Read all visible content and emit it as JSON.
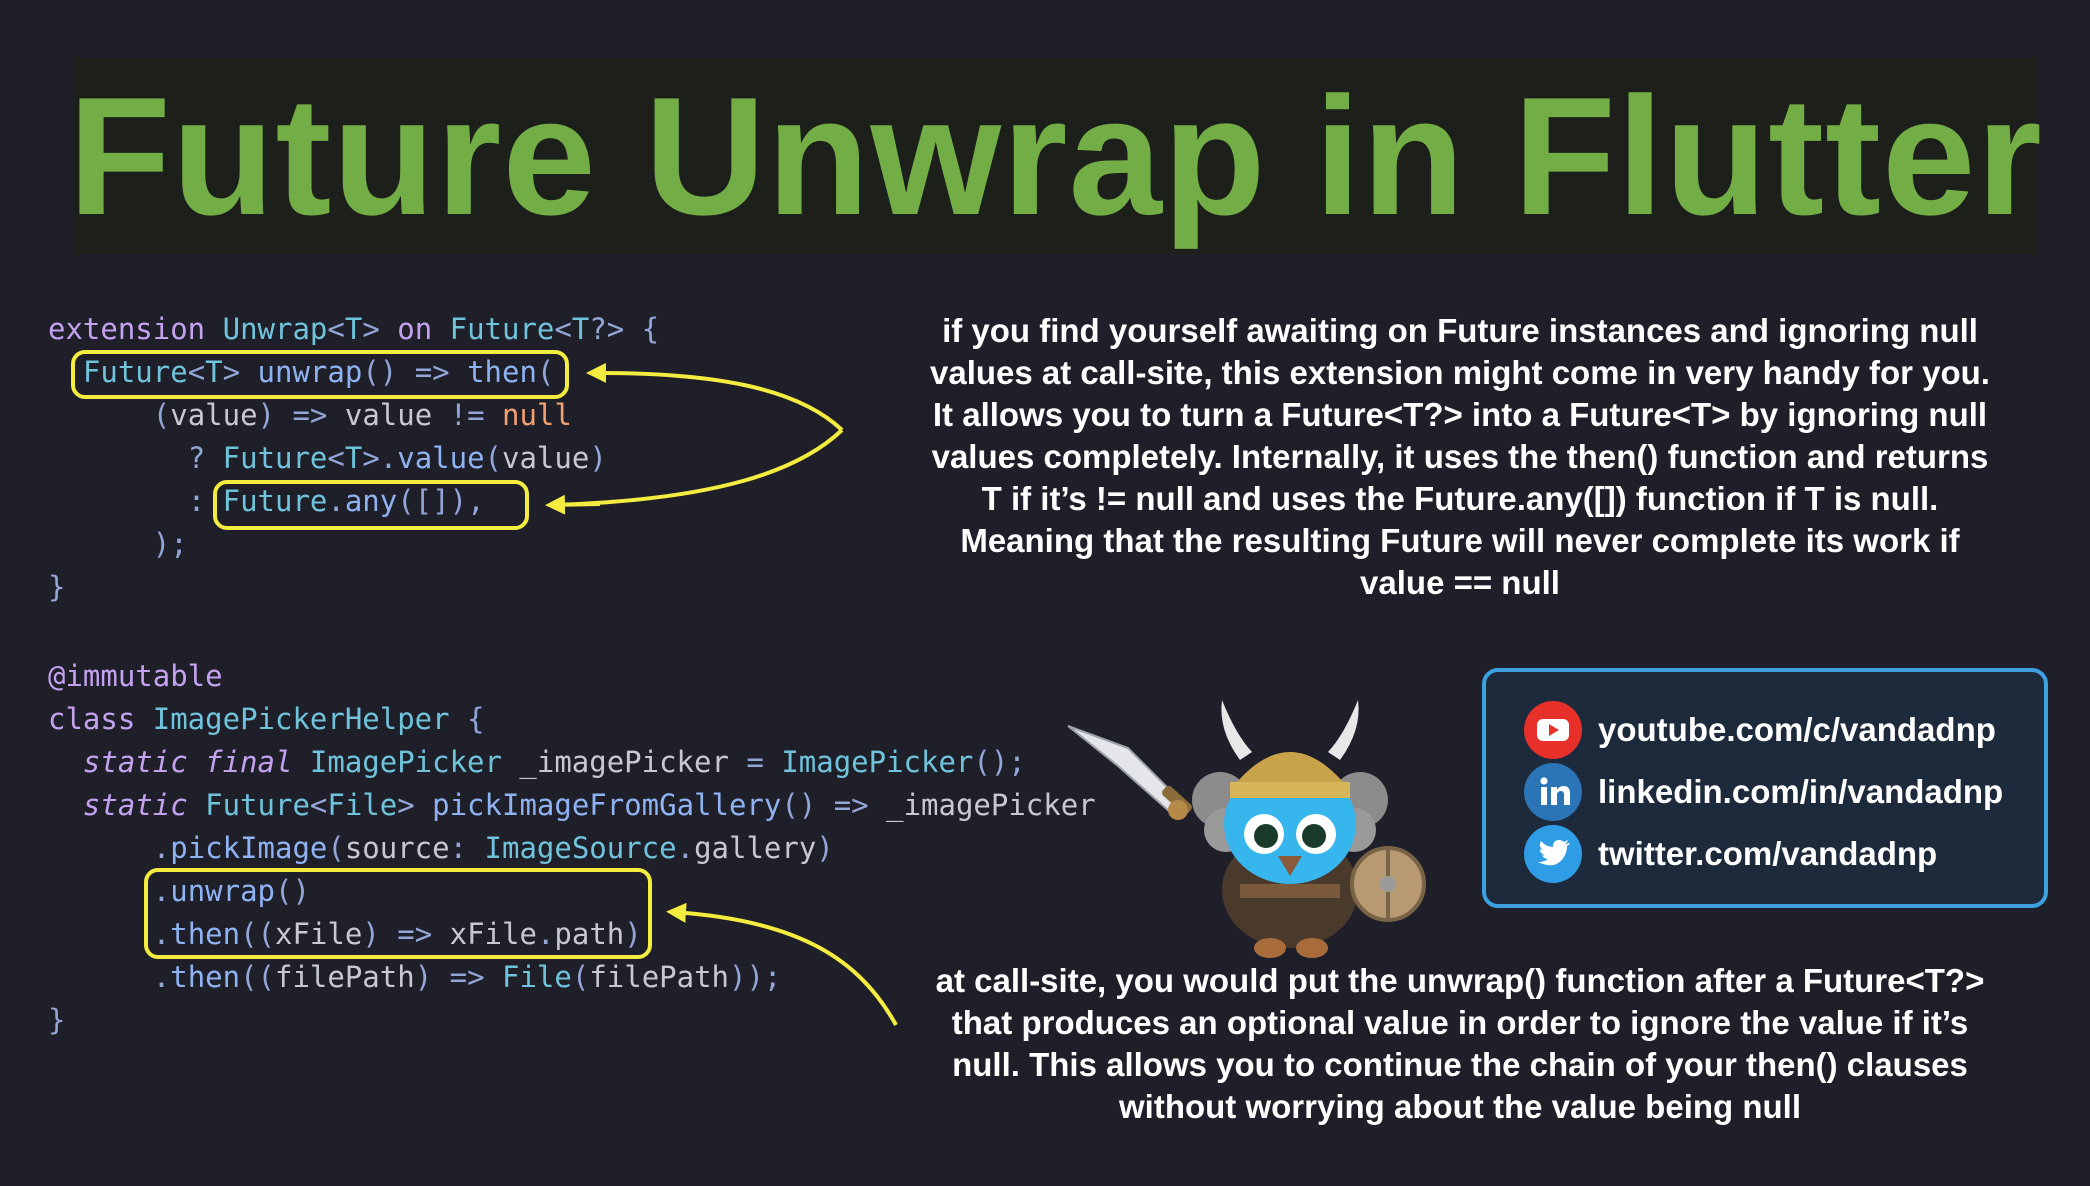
{
  "title": "Future Unwrap in Flutter",
  "code_block_1": [
    [
      [
        "extension ",
        "kw"
      ],
      [
        "Unwrap",
        "ty"
      ],
      [
        "<",
        "pu"
      ],
      [
        "T",
        "ty"
      ],
      [
        "> ",
        "pu"
      ],
      [
        "on ",
        "kw"
      ],
      [
        "Future",
        "ty"
      ],
      [
        "<",
        "pu"
      ],
      [
        "T",
        "ty"
      ],
      [
        "?> {",
        "pu"
      ]
    ],
    [
      [
        "  ",
        "va"
      ],
      [
        "Future",
        "ty"
      ],
      [
        "<",
        "pu"
      ],
      [
        "T",
        "ty"
      ],
      [
        "> ",
        "pu"
      ],
      [
        "unwrap",
        "fn"
      ],
      [
        "() => ",
        "pu"
      ],
      [
        "then",
        "fn"
      ],
      [
        "(",
        "pu"
      ]
    ],
    [
      [
        "      ",
        "va"
      ],
      [
        "(",
        "pu"
      ],
      [
        "value",
        "va"
      ],
      [
        ") => ",
        "pu"
      ],
      [
        "value ",
        "va"
      ],
      [
        "!= ",
        "pu"
      ],
      [
        "null",
        "nu"
      ]
    ],
    [
      [
        "        ",
        "va"
      ],
      [
        "? ",
        "pu"
      ],
      [
        "Future",
        "ty"
      ],
      [
        "<",
        "pu"
      ],
      [
        "T",
        "ty"
      ],
      [
        ">.",
        "pu"
      ],
      [
        "value",
        "fn"
      ],
      [
        "(",
        "pu"
      ],
      [
        "value",
        "va"
      ],
      [
        ")",
        "pu"
      ]
    ],
    [
      [
        "        ",
        "va"
      ],
      [
        ": ",
        "pu"
      ],
      [
        "Future",
        "ty"
      ],
      [
        ".",
        "pu"
      ],
      [
        "any",
        "fn"
      ],
      [
        "([]),",
        "pu"
      ]
    ],
    [
      [
        "      );",
        "pu"
      ]
    ],
    [
      [
        "}",
        "pu"
      ]
    ]
  ],
  "code_block_2": [
    [
      [
        "@immutable",
        "an"
      ]
    ],
    [
      [
        "class ",
        "kw"
      ],
      [
        "ImagePickerHelper ",
        "ty"
      ],
      [
        "{",
        "pu"
      ]
    ],
    [
      [
        "  ",
        "va"
      ],
      [
        "static final ",
        "kw it"
      ],
      [
        "ImagePicker ",
        "ty"
      ],
      [
        "_imagePicker ",
        "va"
      ],
      [
        "= ",
        "pu"
      ],
      [
        "ImagePicker",
        "ty"
      ],
      [
        "();",
        "pu"
      ]
    ],
    [
      [
        "  ",
        "va"
      ],
      [
        "static ",
        "kw it"
      ],
      [
        "Future",
        "ty"
      ],
      [
        "<",
        "pu"
      ],
      [
        "File",
        "ty"
      ],
      [
        "> ",
        "pu"
      ],
      [
        "pickImageFromGallery",
        "fn"
      ],
      [
        "() => ",
        "pu"
      ],
      [
        "_imagePicker",
        "va"
      ]
    ],
    [
      [
        "      ",
        "va"
      ],
      [
        ".",
        "pu"
      ],
      [
        "pickImage",
        "fn"
      ],
      [
        "(",
        "pu"
      ],
      [
        "source",
        "va"
      ],
      [
        ": ",
        "pu"
      ],
      [
        "ImageSource",
        "ty"
      ],
      [
        ".",
        "pu"
      ],
      [
        "gallery",
        "va"
      ],
      [
        ")",
        "pu"
      ]
    ],
    [
      [
        "      ",
        "va"
      ],
      [
        ".",
        "pu"
      ],
      [
        "unwrap",
        "fn"
      ],
      [
        "()",
        "pu"
      ]
    ],
    [
      [
        "      ",
        "va"
      ],
      [
        ".",
        "pu"
      ],
      [
        "then",
        "fn"
      ],
      [
        "((",
        "pu"
      ],
      [
        "xFile",
        "va"
      ],
      [
        ") => ",
        "pu"
      ],
      [
        "xFile",
        "va"
      ],
      [
        ".",
        "pu"
      ],
      [
        "path",
        "va"
      ],
      [
        ")",
        "pu"
      ]
    ],
    [
      [
        "      ",
        "va"
      ],
      [
        ".",
        "pu"
      ],
      [
        "then",
        "fn"
      ],
      [
        "((",
        "pu"
      ],
      [
        "filePath",
        "va"
      ],
      [
        ") => ",
        "pu"
      ],
      [
        "File",
        "ty"
      ],
      [
        "(",
        "pu"
      ],
      [
        "filePath",
        "va"
      ],
      [
        "));",
        "pu"
      ]
    ],
    [
      [
        "}",
        "pu"
      ]
    ]
  ],
  "explanation_1": [
    "if you find yourself awaiting on Future instances and ignoring null",
    "values at call-site, this extension might come in very handy for you.",
    "It allows you to turn a Future<T?> into a Future<T> by ignoring null",
    "values completely. Internally, it uses the then() function and returns",
    "T if it’s != null and uses the Future.any([]) function if T is null.",
    "Meaning that the resulting Future will never complete its work if",
    "value == null"
  ],
  "explanation_2": [
    "at call-site, you would put the unwrap() function after a Future<T?>",
    "that produces an optional value in order to ignore the value if it’s",
    "null. This allows you to continue the chain of your then() clauses",
    "without worrying about the value being null"
  ],
  "social": [
    {
      "icon": "youtube-icon",
      "text": "youtube.com/c/vandadnp",
      "color": "#e8302a"
    },
    {
      "icon": "linkedin-icon",
      "text": "linkedin.com/in/vandadnp",
      "color": "#2b74b6"
    },
    {
      "icon": "twitter-icon",
      "text": "twitter.com/vandadnp",
      "color": "#2f9de6"
    }
  ],
  "colors": {
    "background": "#1f1f2a",
    "title": "#73ad46",
    "highlight": "#f4ec3f",
    "social_border": "#3da0df"
  }
}
